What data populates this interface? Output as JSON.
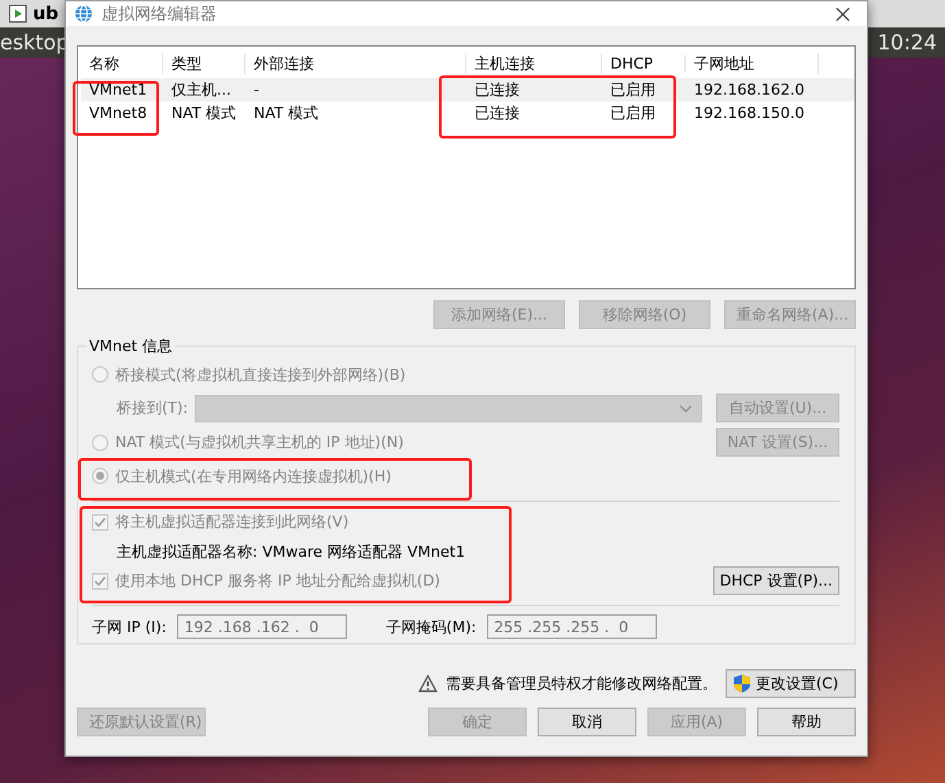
{
  "desktop": {
    "tab_label": "ub",
    "panel_label": "esktop",
    "clock": "10:24"
  },
  "window": {
    "title": "虚拟网络编辑器"
  },
  "network_table": {
    "columns": [
      "名称",
      "类型",
      "外部连接",
      "主机连接",
      "DHCP",
      "子网地址"
    ],
    "rows": [
      {
        "cells": [
          "VMnet1",
          "仅主机...",
          "-",
          "已连接",
          "已启用",
          "192.168.162.0"
        ],
        "selected": true
      },
      {
        "cells": [
          "VMnet8",
          "NAT 模式",
          "NAT 模式",
          "已连接",
          "已启用",
          "192.168.150.0"
        ],
        "selected": false
      }
    ]
  },
  "table_buttons": [
    {
      "label": "添加网络(E)...",
      "disabled": true
    },
    {
      "label": "移除网络(O)",
      "disabled": true
    },
    {
      "label": "重命名网络(A)...",
      "disabled": true
    }
  ],
  "vmnet_info": {
    "title": "VMnet 信息",
    "bridged_mode": {
      "label": "桥接模式(将虚拟机直接连接到外部网络)(B)",
      "selected": false,
      "disabled": true
    },
    "bridge_to": {
      "label": "桥接到(T):",
      "disabled": true
    },
    "auto_settings_button": {
      "label": "自动设置(U)...",
      "disabled": true
    },
    "nat_mode": {
      "label": "NAT 模式(与虚拟机共享主机的 IP 地址)(N)",
      "selected": false,
      "disabled": true
    },
    "nat_settings_button": {
      "label": "NAT 设置(S)...",
      "disabled": true
    },
    "host_only_mode": {
      "label": "仅主机模式(在专用网络内连接虚拟机)(H)",
      "selected": true,
      "disabled": true
    },
    "connect_adapter": {
      "label": "将主机虚拟适配器连接到此网络(V)",
      "checked": true,
      "disabled": true
    },
    "adapter_name": "主机虚拟适配器名称: VMware 网络适配器 VMnet1",
    "use_dhcp": {
      "label": "使用本地 DHCP 服务将 IP 地址分配给虚拟机(D)",
      "checked": true,
      "disabled": true
    },
    "dhcp_settings_button": {
      "label": "DHCP 设置(P)...",
      "disabled": false
    },
    "subnet_ip": {
      "label": "子网 IP (I):",
      "value": "192 .168 .162 .  0"
    },
    "subnet_mask": {
      "label": "子网掩码(M):",
      "value": "255 .255 .255 .  0"
    }
  },
  "admin_notice": "需要具备管理员特权才能修改网络配置。",
  "change_settings_button": {
    "label": "更改设置(C)",
    "disabled": false
  },
  "restore_defaults_button": {
    "label": "还原默认设置(R)",
    "disabled": true
  },
  "dialog_buttons": [
    {
      "label": "确定",
      "disabled": true
    },
    {
      "label": "取消",
      "disabled": false
    },
    {
      "label": "应用(A)",
      "disabled": true
    },
    {
      "label": "帮助",
      "disabled": false
    }
  ]
}
